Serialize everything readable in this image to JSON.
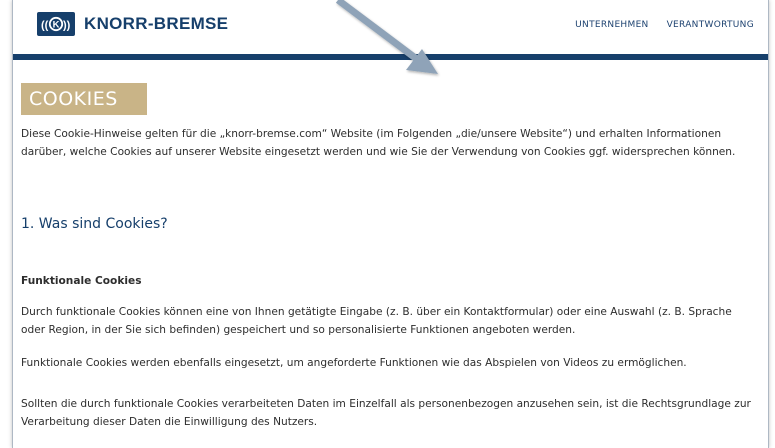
{
  "header": {
    "brand": "KNORR-BREMSE",
    "nav": [
      "UNTERNEHMEN",
      "VERANTWORTUNG"
    ]
  },
  "page": {
    "title": "COOKIES",
    "intro": "Diese Cookie-Hinweise gelten für die „knorr-bremse.com“ Website (im Folgenden „die/unsere Website“) und erhalten Informationen darüber, welche Cookies auf unserer Website eingesetzt werden und wie Sie der Verwendung von Cookies ggf. widersprechen können.",
    "section1_heading": "1. Was sind Cookies?",
    "functional_heading": "Funktionale Cookies",
    "functional_p1": "Durch funktionale Cookies können eine von Ihnen getätigte Eingabe (z. B. über ein Kontaktformular) oder eine Auswahl (z. B. Sprache oder Region, in der Sie sich befinden) gespeichert und so personalisierte Funktionen angeboten werden.",
    "functional_p2": "Funktionale Cookies werden ebenfalls eingesetzt, um angeforderte Funktionen wie das Abspielen von Videos zu ermöglichen.",
    "functional_p3": "Sollten die durch funktionale Cookies verarbeiteten Daten im Einzelfall als personenbezogen anzusehen sein, ist die Rechtsgrundlage zur Verarbeitung dieser Daten die Einwilligung des Nutzers."
  },
  "colors": {
    "brand_blue": "#163f6b",
    "title_tan": "#c9b487",
    "annotation_arrow": "#8fa3b8"
  },
  "icons": {
    "logo": "knorr-bremse-logo-icon",
    "annotation": "arrow-annotation-icon"
  }
}
